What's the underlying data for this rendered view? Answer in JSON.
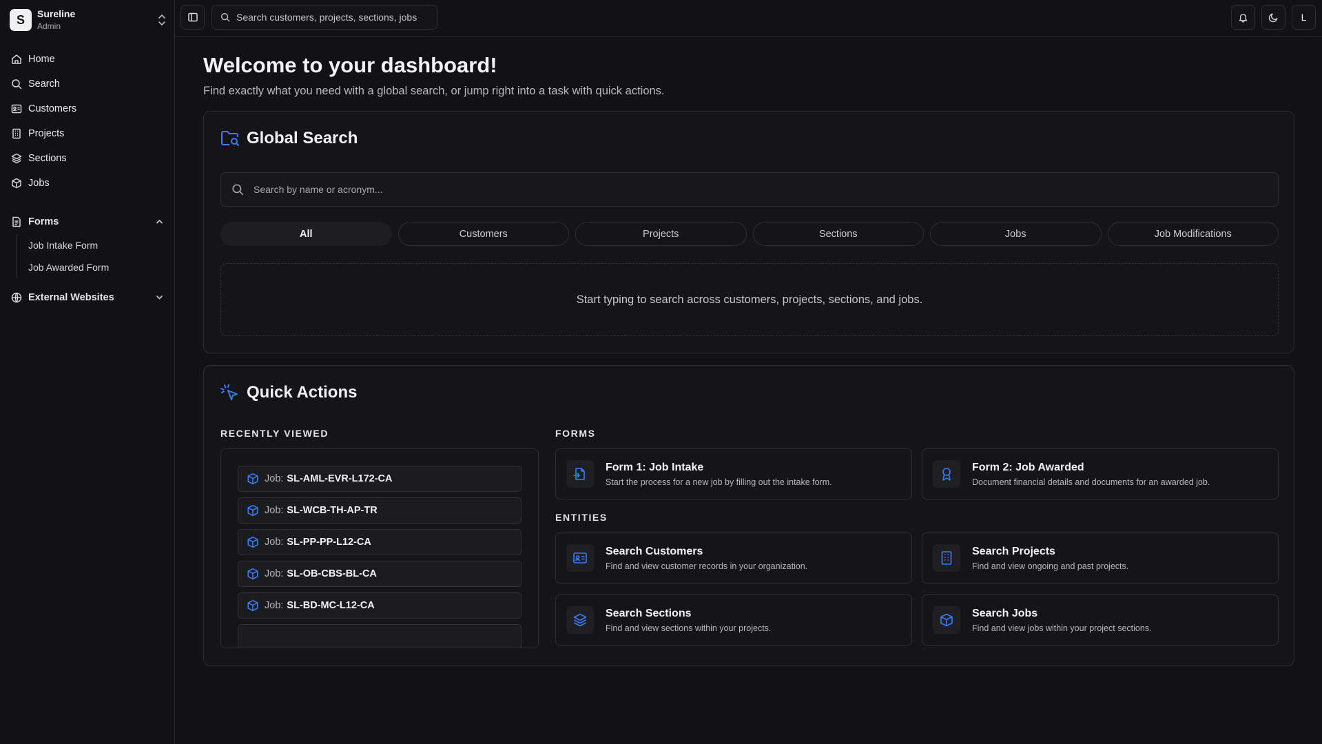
{
  "sidebar": {
    "brand": {
      "initial": "S",
      "name": "Sureline",
      "role": "Admin"
    },
    "nav": [
      {
        "label": "Home",
        "icon": "home-icon"
      },
      {
        "label": "Search",
        "icon": "search-icon"
      },
      {
        "label": "Customers",
        "icon": "id-card-icon"
      },
      {
        "label": "Projects",
        "icon": "building-icon"
      },
      {
        "label": "Sections",
        "icon": "layers-icon"
      },
      {
        "label": "Jobs",
        "icon": "box-icon"
      }
    ],
    "forms_group": {
      "label": "Forms",
      "items": [
        "Job Intake Form",
        "Job Awarded Form"
      ]
    },
    "external_group": {
      "label": "External Websites"
    }
  },
  "topbar": {
    "search_placeholder": "Search customers, projects, sections, jobs",
    "avatar_initial": "L"
  },
  "main": {
    "title": "Welcome to your dashboard!",
    "subtitle": "Find exactly what you need with a global search, or jump right into a task with quick actions."
  },
  "global_search": {
    "title": "Global Search",
    "placeholder": "Search by name or acronym...",
    "filters": [
      "All",
      "Customers",
      "Projects",
      "Sections",
      "Jobs",
      "Job Modifications"
    ],
    "active_filter": "All",
    "empty_text": "Start typing to search across customers, projects, sections, and jobs."
  },
  "quick_actions": {
    "title": "Quick Actions",
    "recent_label": "RECENTLY VIEWED",
    "recent_prefix": "Job:",
    "recent": [
      "SL-AML-EVR-L172-CA",
      "SL-WCB-TH-AP-TR",
      "SL-PP-PP-L12-CA",
      "SL-OB-CBS-BL-CA",
      "SL-BD-MC-L12-CA"
    ],
    "forms_label": "FORMS",
    "forms": [
      {
        "title": "Form 1: Job Intake",
        "desc": "Start the process for a new job by filling out the intake form.",
        "icon": "file-import-icon"
      },
      {
        "title": "Form 2: Job Awarded",
        "desc": "Document financial details and documents for an awarded job.",
        "icon": "award-ribbon-icon"
      }
    ],
    "entities_label": "ENTITIES",
    "entities": [
      {
        "title": "Search Customers",
        "desc": "Find and view customer records in your organization.",
        "icon": "id-card-icon"
      },
      {
        "title": "Search Projects",
        "desc": "Find and view ongoing and past projects.",
        "icon": "building-icon"
      },
      {
        "title": "Search Sections",
        "desc": "Find and view sections within your projects.",
        "icon": "layers-icon"
      },
      {
        "title": "Search Jobs",
        "desc": "Find and view jobs within your project sections.",
        "icon": "box-icon"
      }
    ]
  },
  "colors": {
    "accent": "#3b7cf5",
    "background": "#121214",
    "card": "#151517",
    "border": "#2e2e33"
  }
}
